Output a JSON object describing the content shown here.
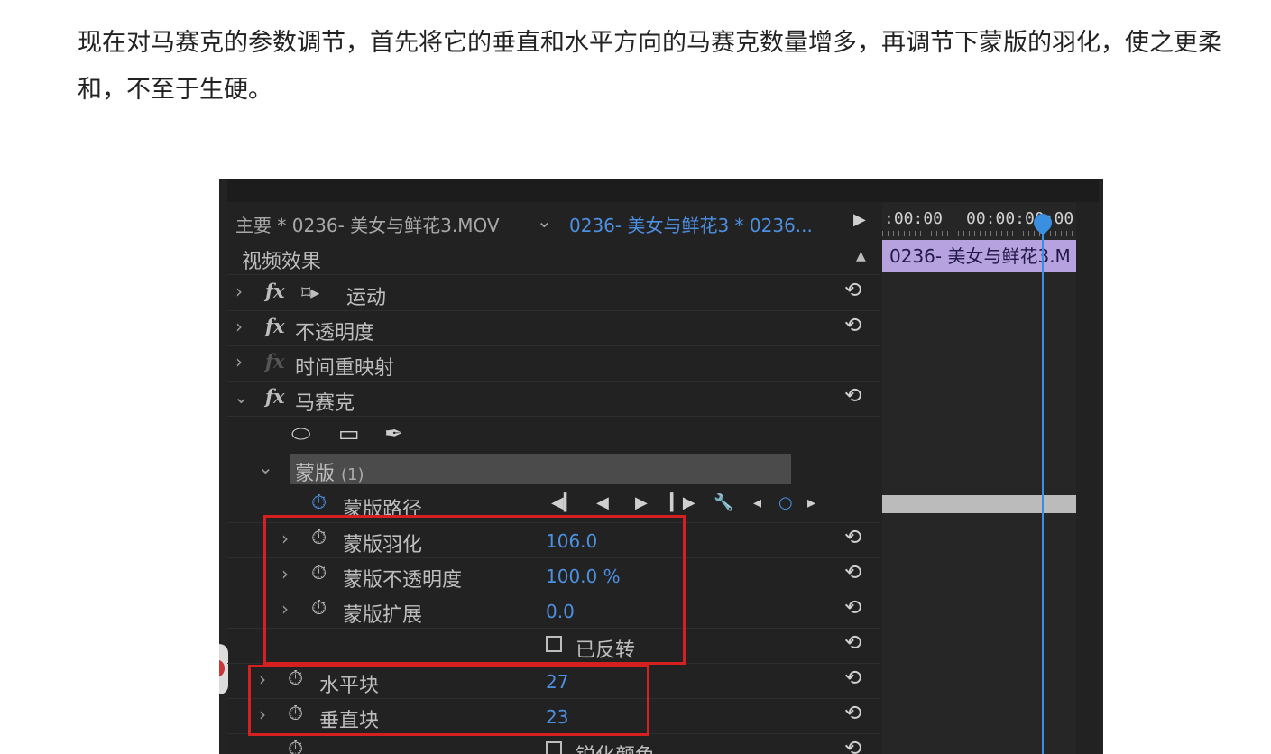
{
  "article": {
    "paragraph": "现在对马赛克的参数调节，首先将它的垂直和水平方向的马赛克数量增多，再调节下蒙版的羽化，使之更柔和，不至于生硬。"
  },
  "panel": {
    "sequence_label": "主要 * 0236- 美女与鲜花3.MOV",
    "dropdown_glyph": "⌄",
    "clip_label": "0236- 美女与鲜花3 * 0236...",
    "play_glyph": "▶",
    "section_title": "视频效果",
    "collapse_glyph": "▲",
    "reset_glyph": "⟲",
    "fx_glyph": "fx",
    "chev_right": "›",
    "chev_down": "⌄",
    "stopwatch_glyph": "⏱",
    "motion_icon": "⌑▸",
    "effects": {
      "motion": "运动",
      "opacity": "不透明度",
      "time_remap": "时间重映射",
      "mosaic": "马赛克"
    },
    "mask_tools": {
      "ellipse_icon": "⬭",
      "rect_icon": "▭",
      "pen_icon": "✒"
    },
    "mask_group": {
      "label": "蒙版",
      "count": "(1)"
    },
    "mask_path_label": "蒙版路径",
    "keyframe_controls": [
      "◀▎",
      "◀",
      "▶",
      "▎▶",
      "🔧",
      "◂",
      "○",
      "▸"
    ],
    "params": {
      "mask_feather": {
        "label": "蒙版羽化",
        "value": "106.0"
      },
      "mask_opacity": {
        "label": "蒙版不透明度",
        "value": "100.0 %"
      },
      "mask_expansion": {
        "label": "蒙版扩展",
        "value": "0.0"
      },
      "inverted": {
        "label": "已反转"
      },
      "horizontal_blocks": {
        "label": "水平块",
        "value": "27"
      },
      "vertical_blocks": {
        "label": "垂直块",
        "value": "23"
      },
      "sharpen_colors": {
        "label": "锐化颜色"
      }
    }
  },
  "timeline": {
    "time_left": ":00:00",
    "time_right": "00:00:00:00",
    "clip_name": "0236- 美女与鲜花3.M"
  },
  "colors": {
    "highlight_box": "#d42020",
    "value_blue": "#4d8fe0",
    "clip_purple": "#b6a2df",
    "playhead": "#3b8fe0"
  }
}
